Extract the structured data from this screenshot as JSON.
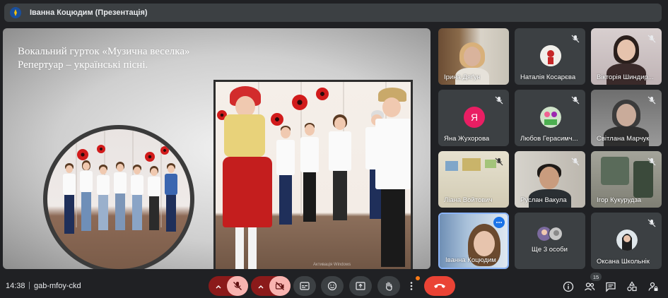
{
  "topbar": {
    "presenter_label": "Іванна Коцюдим (Презентація)"
  },
  "slide": {
    "title_line1": "Вокальний гурток  «Музична веселка»",
    "title_line2": "Репертуар – українські пісні.",
    "watermark": "Активація Windows"
  },
  "tiles": [
    {
      "name": "Ірина Дяґун",
      "type": "video",
      "muted": false
    },
    {
      "name": "Наталія Косарєва",
      "type": "avatar",
      "muted": true
    },
    {
      "name": "Вікторія Шиндир...",
      "type": "video",
      "muted": true
    },
    {
      "name": "Яна Жухорова",
      "type": "letter",
      "letter": "Я",
      "muted": true,
      "avatar_color": "#e91e63"
    },
    {
      "name": "Любов Герасимч...",
      "type": "avatar",
      "muted": true
    },
    {
      "name": "Світлана Марчук",
      "type": "video",
      "muted": true
    },
    {
      "name": "Ліана Войтович",
      "type": "video",
      "muted": true
    },
    {
      "name": "Руслан Вакула",
      "type": "video",
      "muted": true
    },
    {
      "name": "Ігор Кукурудза",
      "type": "video",
      "muted": true
    },
    {
      "name": "Іванна Коцюдим",
      "type": "video",
      "muted": false,
      "active": true
    },
    {
      "name": "Ще 3 особи",
      "type": "group",
      "muted": false
    },
    {
      "name": "Оксана Школьнік",
      "type": "avatar",
      "muted": true
    }
  ],
  "bottombar": {
    "time": "14:38",
    "separator": "|",
    "meeting_code": "gab-mfoy-ckd",
    "participants_count": "15"
  },
  "colors": {
    "background": "#202124",
    "tile": "#3c4043",
    "end_call": "#ea4335",
    "active_border": "#8ab4f8"
  }
}
